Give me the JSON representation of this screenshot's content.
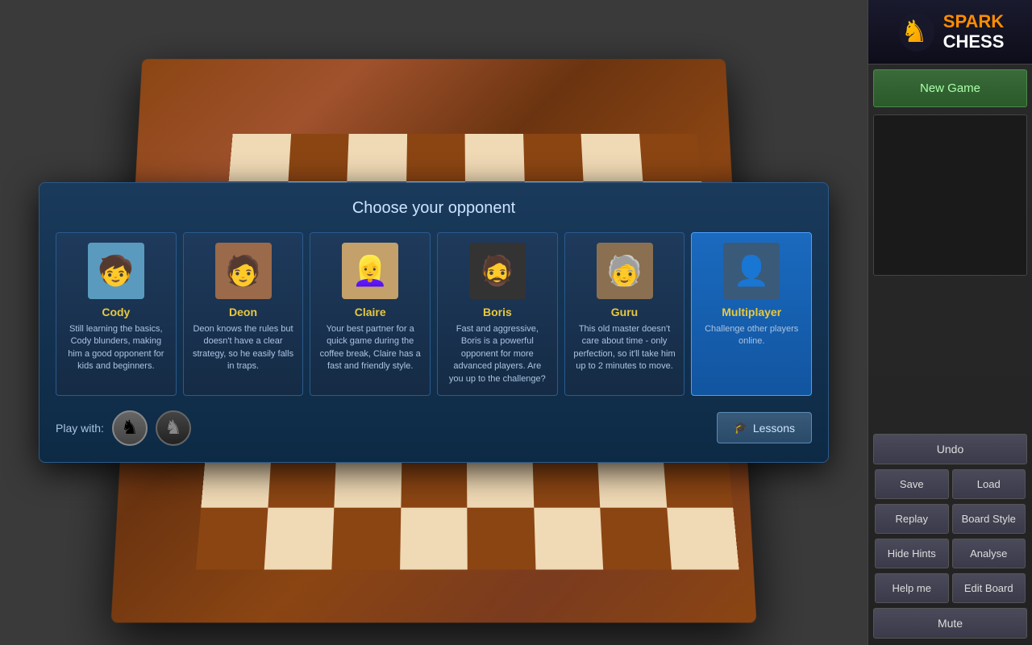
{
  "app": {
    "title_spark": "SPARK",
    "title_chess": "CHESS"
  },
  "sidebar": {
    "new_game_label": "New Game",
    "undo_label": "Undo",
    "save_label": "Save",
    "load_label": "Load",
    "replay_label": "Replay",
    "board_style_label": "Board Style",
    "hide_hints_label": "Hide Hints",
    "analyse_label": "Analyse",
    "help_me_label": "Help me",
    "edit_board_label": "Edit Board",
    "mute_label": "Mute"
  },
  "modal": {
    "title": "Choose your opponent",
    "play_with_label": "Play with:",
    "lessons_label": "Lessons"
  },
  "opponents": [
    {
      "id": "cody",
      "name": "Cody",
      "name_class": "cody",
      "description": "Still learning the basics, Cody blunders, making him a good opponent for kids and beginners.",
      "selected": false
    },
    {
      "id": "deon",
      "name": "Deon",
      "name_class": "deon",
      "description": "Deon knows the rules but doesn't have a clear strategy, so he easily falls in traps.",
      "selected": false
    },
    {
      "id": "claire",
      "name": "Claire",
      "name_class": "claire",
      "description": "Your best partner for a quick game during the coffee break, Claire has a fast and friendly style.",
      "selected": false
    },
    {
      "id": "boris",
      "name": "Boris",
      "name_class": "boris",
      "description": "Fast and aggressive, Boris is a powerful opponent for more advanced players. Are you up to the challenge?",
      "selected": false
    },
    {
      "id": "guru",
      "name": "Guru",
      "name_class": "guru",
      "description": "This old master doesn't care about time - only perfection, so it'll take him up to 2 minutes to move.",
      "selected": false
    },
    {
      "id": "multiplayer",
      "name": "Multiplayer",
      "name_class": "multi",
      "description": "Challenge other players online.",
      "selected": true
    }
  ]
}
